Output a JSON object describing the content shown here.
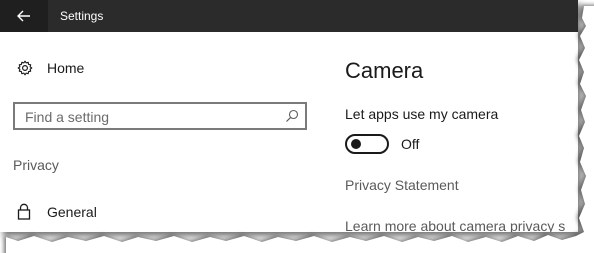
{
  "window": {
    "title": "Settings"
  },
  "sidebar": {
    "home_label": "Home",
    "search_placeholder": "Find a setting",
    "section_label": "Privacy",
    "items": [
      {
        "label": "General"
      }
    ]
  },
  "main": {
    "page_title": "Camera",
    "setting_label": "Let apps use my camera",
    "toggle_state": "Off",
    "toggle_on": false,
    "privacy_link": "Privacy Statement",
    "learn_more_link": "Learn more about camera privacy s"
  },
  "colors": {
    "titlebar": "#2b2b2b",
    "back_button": "#1f1f1f",
    "text": "#1a1a1a",
    "secondary_text": "#5a5a5a"
  },
  "icons": {
    "back": "arrow-left-icon",
    "home": "gear-icon",
    "search": "search-icon",
    "general": "lock-icon"
  }
}
